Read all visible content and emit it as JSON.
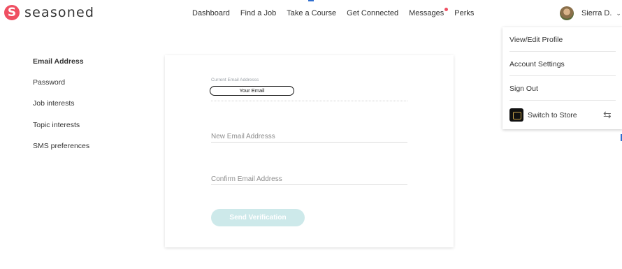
{
  "brand": {
    "name": "seasoned",
    "logo_letter": "S",
    "accent": "#ef4f62"
  },
  "nav": [
    {
      "label": "Dashboard"
    },
    {
      "label": "Find a Job"
    },
    {
      "label": "Take a Course"
    },
    {
      "label": "Get Connected"
    },
    {
      "label": "Messages",
      "badge": true
    },
    {
      "label": "Perks"
    }
  ],
  "user": {
    "name": "Sierra D.",
    "caret": "⌄"
  },
  "dropdown": {
    "items": [
      "View/Edit Profile",
      "Account Settings",
      "Sign Out"
    ],
    "store_label": "Switch to Store",
    "swap_icon": "⇆"
  },
  "sidebar": {
    "items": [
      "Email Address",
      "Password",
      "Job interests",
      "Topic interests",
      "SMS preferences"
    ],
    "active": "Email Address"
  },
  "form": {
    "current_label": "Current Email Addresss",
    "current_value": "Your Email",
    "new_placeholder": "New Email Addresss",
    "confirm_placeholder": "Confirm Email Address",
    "button_label": "Send Verification",
    "button_color": "#cde9ea"
  }
}
